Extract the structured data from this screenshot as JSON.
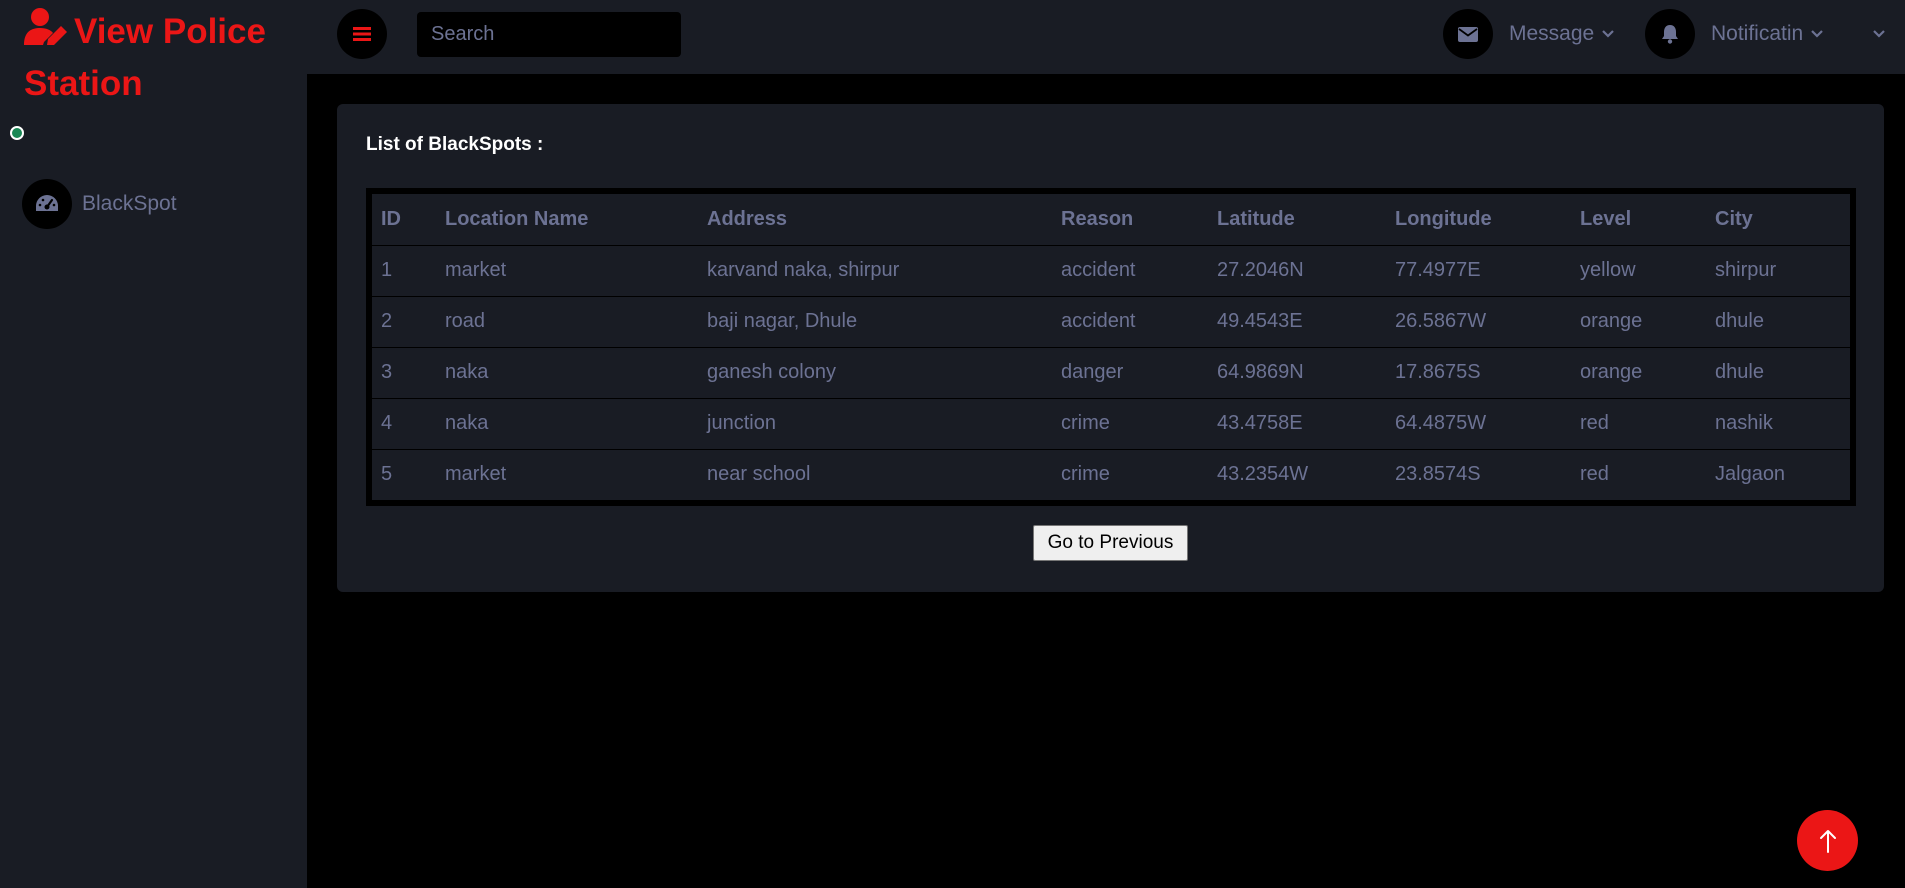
{
  "brand": {
    "title": "View Police Station",
    "icon": "user-edit-icon"
  },
  "sidebar": {
    "items": [
      {
        "label": "BlackSpot",
        "icon": "tachometer-icon"
      }
    ]
  },
  "topbar": {
    "search": {
      "placeholder": "Search"
    },
    "message": {
      "label": "Message",
      "icon": "envelope-icon"
    },
    "notification": {
      "label": "Notificatin",
      "icon": "bell-icon"
    }
  },
  "panel": {
    "title": "List of BlackSpots :",
    "columns": [
      "ID",
      "Location Name",
      "Address",
      "Reason",
      "Latitude",
      "Longitude",
      "Level",
      "City"
    ],
    "rows": [
      [
        "1",
        "market",
        "karvand naka, shirpur",
        "accident",
        "27.2046N",
        "77.4977E",
        "yellow",
        "shirpur"
      ],
      [
        "2",
        "road",
        "baji nagar, Dhule",
        "accident",
        "49.4543E",
        "26.5867W",
        "orange",
        "dhule"
      ],
      [
        "3",
        "naka",
        "ganesh colony",
        "danger",
        "64.9869N",
        "17.8675S",
        "orange",
        "dhule"
      ],
      [
        "4",
        "naka",
        "junction",
        "crime",
        "43.4758E",
        "64.4875W",
        "red",
        "nashik"
      ],
      [
        "5",
        "market",
        "near school",
        "crime",
        "43.2354W",
        "23.8574S",
        "red",
        "Jalgaon"
      ]
    ],
    "button_label": "Go to Previous"
  },
  "colors": {
    "accent": "#eb1616",
    "surface": "#191c24",
    "background": "#000000",
    "muted_text": "#6c7293",
    "status_dot": "#198754"
  }
}
